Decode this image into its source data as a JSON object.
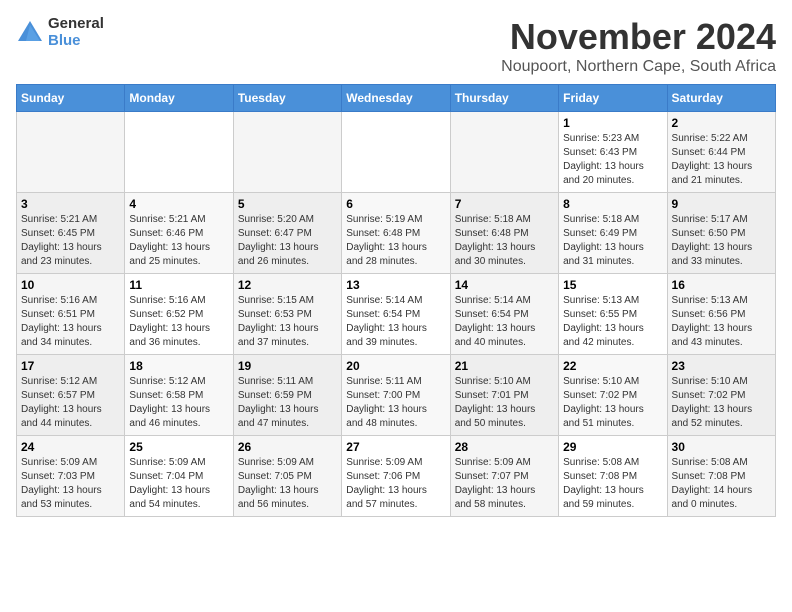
{
  "header": {
    "logo_line1": "General",
    "logo_line2": "Blue",
    "month": "November 2024",
    "location": "Noupoort, Northern Cape, South Africa"
  },
  "weekdays": [
    "Sunday",
    "Monday",
    "Tuesday",
    "Wednesday",
    "Thursday",
    "Friday",
    "Saturday"
  ],
  "weeks": [
    [
      {
        "day": "",
        "info": ""
      },
      {
        "day": "",
        "info": ""
      },
      {
        "day": "",
        "info": ""
      },
      {
        "day": "",
        "info": ""
      },
      {
        "day": "",
        "info": ""
      },
      {
        "day": "1",
        "info": "Sunrise: 5:23 AM\nSunset: 6:43 PM\nDaylight: 13 hours\nand 20 minutes."
      },
      {
        "day": "2",
        "info": "Sunrise: 5:22 AM\nSunset: 6:44 PM\nDaylight: 13 hours\nand 21 minutes."
      }
    ],
    [
      {
        "day": "3",
        "info": "Sunrise: 5:21 AM\nSunset: 6:45 PM\nDaylight: 13 hours\nand 23 minutes."
      },
      {
        "day": "4",
        "info": "Sunrise: 5:21 AM\nSunset: 6:46 PM\nDaylight: 13 hours\nand 25 minutes."
      },
      {
        "day": "5",
        "info": "Sunrise: 5:20 AM\nSunset: 6:47 PM\nDaylight: 13 hours\nand 26 minutes."
      },
      {
        "day": "6",
        "info": "Sunrise: 5:19 AM\nSunset: 6:48 PM\nDaylight: 13 hours\nand 28 minutes."
      },
      {
        "day": "7",
        "info": "Sunrise: 5:18 AM\nSunset: 6:48 PM\nDaylight: 13 hours\nand 30 minutes."
      },
      {
        "day": "8",
        "info": "Sunrise: 5:18 AM\nSunset: 6:49 PM\nDaylight: 13 hours\nand 31 minutes."
      },
      {
        "day": "9",
        "info": "Sunrise: 5:17 AM\nSunset: 6:50 PM\nDaylight: 13 hours\nand 33 minutes."
      }
    ],
    [
      {
        "day": "10",
        "info": "Sunrise: 5:16 AM\nSunset: 6:51 PM\nDaylight: 13 hours\nand 34 minutes."
      },
      {
        "day": "11",
        "info": "Sunrise: 5:16 AM\nSunset: 6:52 PM\nDaylight: 13 hours\nand 36 minutes."
      },
      {
        "day": "12",
        "info": "Sunrise: 5:15 AM\nSunset: 6:53 PM\nDaylight: 13 hours\nand 37 minutes."
      },
      {
        "day": "13",
        "info": "Sunrise: 5:14 AM\nSunset: 6:54 PM\nDaylight: 13 hours\nand 39 minutes."
      },
      {
        "day": "14",
        "info": "Sunrise: 5:14 AM\nSunset: 6:54 PM\nDaylight: 13 hours\nand 40 minutes."
      },
      {
        "day": "15",
        "info": "Sunrise: 5:13 AM\nSunset: 6:55 PM\nDaylight: 13 hours\nand 42 minutes."
      },
      {
        "day": "16",
        "info": "Sunrise: 5:13 AM\nSunset: 6:56 PM\nDaylight: 13 hours\nand 43 minutes."
      }
    ],
    [
      {
        "day": "17",
        "info": "Sunrise: 5:12 AM\nSunset: 6:57 PM\nDaylight: 13 hours\nand 44 minutes."
      },
      {
        "day": "18",
        "info": "Sunrise: 5:12 AM\nSunset: 6:58 PM\nDaylight: 13 hours\nand 46 minutes."
      },
      {
        "day": "19",
        "info": "Sunrise: 5:11 AM\nSunset: 6:59 PM\nDaylight: 13 hours\nand 47 minutes."
      },
      {
        "day": "20",
        "info": "Sunrise: 5:11 AM\nSunset: 7:00 PM\nDaylight: 13 hours\nand 48 minutes."
      },
      {
        "day": "21",
        "info": "Sunrise: 5:10 AM\nSunset: 7:01 PM\nDaylight: 13 hours\nand 50 minutes."
      },
      {
        "day": "22",
        "info": "Sunrise: 5:10 AM\nSunset: 7:02 PM\nDaylight: 13 hours\nand 51 minutes."
      },
      {
        "day": "23",
        "info": "Sunrise: 5:10 AM\nSunset: 7:02 PM\nDaylight: 13 hours\nand 52 minutes."
      }
    ],
    [
      {
        "day": "24",
        "info": "Sunrise: 5:09 AM\nSunset: 7:03 PM\nDaylight: 13 hours\nand 53 minutes."
      },
      {
        "day": "25",
        "info": "Sunrise: 5:09 AM\nSunset: 7:04 PM\nDaylight: 13 hours\nand 54 minutes."
      },
      {
        "day": "26",
        "info": "Sunrise: 5:09 AM\nSunset: 7:05 PM\nDaylight: 13 hours\nand 56 minutes."
      },
      {
        "day": "27",
        "info": "Sunrise: 5:09 AM\nSunset: 7:06 PM\nDaylight: 13 hours\nand 57 minutes."
      },
      {
        "day": "28",
        "info": "Sunrise: 5:09 AM\nSunset: 7:07 PM\nDaylight: 13 hours\nand 58 minutes."
      },
      {
        "day": "29",
        "info": "Sunrise: 5:08 AM\nSunset: 7:08 PM\nDaylight: 13 hours\nand 59 minutes."
      },
      {
        "day": "30",
        "info": "Sunrise: 5:08 AM\nSunset: 7:08 PM\nDaylight: 14 hours\nand 0 minutes."
      }
    ]
  ]
}
